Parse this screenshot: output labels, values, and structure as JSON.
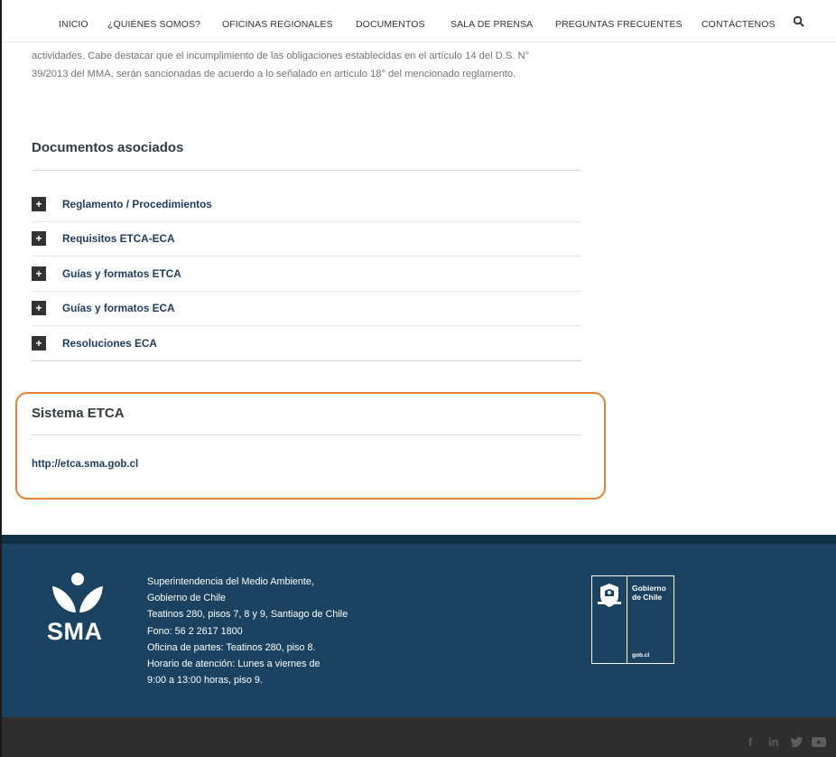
{
  "nav": {
    "items": [
      {
        "label": "INICIO"
      },
      {
        "label": "¿QUIÉNES SOMOS?"
      },
      {
        "label": "OFICINAS REGIONALES"
      },
      {
        "label": "DOCUMENTOS"
      },
      {
        "label": "SALA DE PRENSA"
      },
      {
        "label": "PREGUNTAS FRECUENTES"
      },
      {
        "label": "CONTÁCTENOS"
      }
    ],
    "search_icon": "search-icon"
  },
  "intro": {
    "line1": "actividades. Cabe destacar que el incumplimiento de las obligaciones establecidas en el artículo 14 del D.S. N°",
    "line2": "39/2013 del MMA, serán sancionadas de acuerdo a lo señalado en artículo 18° del mencionado reglamento."
  },
  "documents": {
    "title": "Documentos asociados",
    "items": [
      {
        "label": "Reglamento / Procedimientos"
      },
      {
        "label": "Requisitos ETCA-ECA"
      },
      {
        "label": "Guías y formatos ETCA"
      },
      {
        "label": "Guías y formatos ECA"
      },
      {
        "label": "Resoluciones ECA"
      }
    ],
    "expand_symbol": "+"
  },
  "etca": {
    "title": "Sistema ETCA",
    "link": "http://etca.sma.gob.cl",
    "highlight_color": "#e8822e"
  },
  "footer": {
    "logo_text": "SMA",
    "lines": [
      "Superintendencia del Medio Ambiente,",
      "Gobierno de Chile",
      "Teatinos 280, pisos 7, 8 y 9, Santiago de Chile",
      "Fono: 56 2 2617 1800",
      "Oficina de partes: Teatinos 280, piso 8.",
      "Horario de atención: Lunes a viernes de",
      "9:00 a 13:00 horas, piso 9."
    ],
    "gob": {
      "line1": "Gobierno",
      "line2": "de Chile",
      "url": "gob.cl"
    },
    "background": "#1b4361"
  },
  "social": {
    "facebook": "f",
    "linkedin": "in",
    "icons": [
      "facebook-icon",
      "linkedin-icon",
      "twitter-icon",
      "youtube-icon"
    ]
  }
}
